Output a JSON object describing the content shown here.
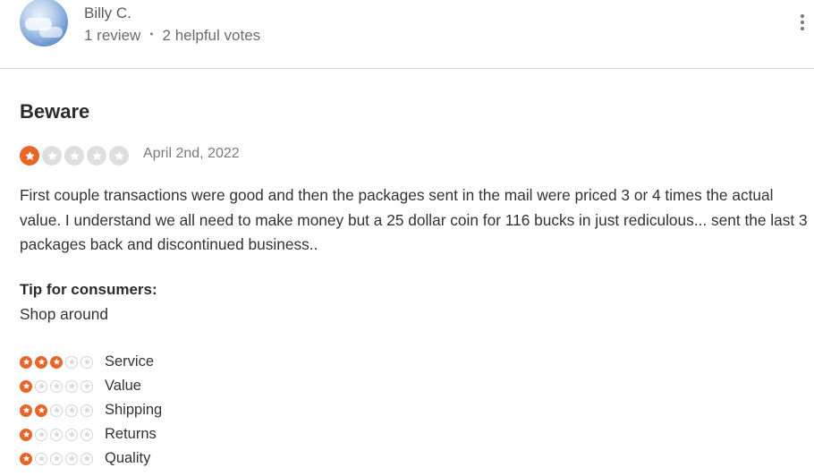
{
  "reviewer": {
    "name": "Billy C.",
    "review_count": "1 review",
    "separator": "•",
    "helpful_votes": "2 helpful votes"
  },
  "review": {
    "title": "Beware",
    "rating": 1,
    "max_rating": 5,
    "date": "April 2nd, 2022",
    "body": "First couple transactions were good and then the packages sent in the mail were priced 3 or 4 times the actual value. I understand we all need to make money but a 25 dollar coin for 116 bucks in just rediculous... sent the last 3 packages back and discontinued business..",
    "tip_label": "Tip for consumers:",
    "tip_text": "Shop around"
  },
  "sub_ratings": [
    {
      "label": "Service",
      "value": 3
    },
    {
      "label": "Value",
      "value": 1
    },
    {
      "label": "Shipping",
      "value": 2
    },
    {
      "label": "Returns",
      "value": 1
    },
    {
      "label": "Quality",
      "value": 1
    }
  ],
  "colors": {
    "star_filled": "#e8652a",
    "star_empty_large": "#dedede",
    "star_empty_small_border": "#d3d3d3"
  },
  "icons": {
    "avatar": "avatar-photo",
    "menu": "kebab-menu-icon",
    "star": "star-icon"
  }
}
